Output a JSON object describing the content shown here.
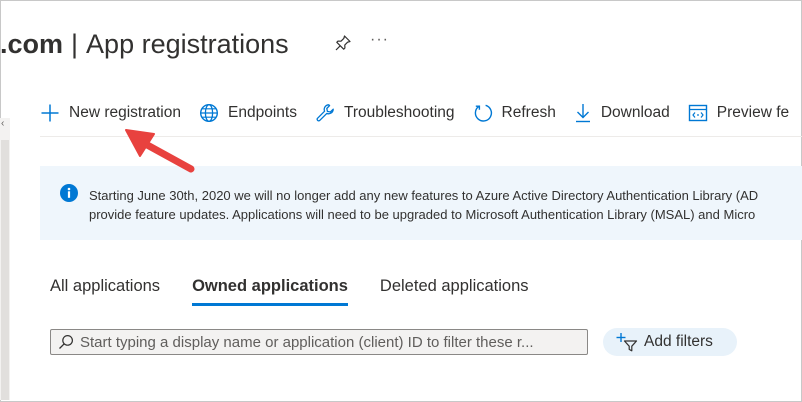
{
  "header": {
    "domain_suffix": ".com",
    "separator": "|",
    "title": "App registrations",
    "more_label": "···"
  },
  "toolbar": {
    "items": [
      {
        "label": "New registration",
        "icon": "plus-icon"
      },
      {
        "label": "Endpoints",
        "icon": "globe-icon"
      },
      {
        "label": "Troubleshooting",
        "icon": "wrench-icon"
      },
      {
        "label": "Refresh",
        "icon": "refresh-icon"
      },
      {
        "label": "Download",
        "icon": "download-icon"
      },
      {
        "label": "Preview fe",
        "icon": "preview-icon"
      }
    ]
  },
  "info_banner": {
    "line1": "Starting June 30th, 2020 we will no longer add any new features to Azure Active Directory Authentication Library (AD",
    "line2": "provide feature updates. Applications will need to be upgraded to Microsoft Authentication Library (MSAL) and Micro"
  },
  "tabs": [
    {
      "label": "All applications",
      "active": false
    },
    {
      "label": "Owned applications",
      "active": true
    },
    {
      "label": "Deleted applications",
      "active": false
    }
  ],
  "search": {
    "placeholder": "Start typing a display name or application (client) ID to filter these r...",
    "value": ""
  },
  "filters": {
    "add_label": "Add filters"
  },
  "colors": {
    "accent": "#0078d4",
    "callout_arrow": "#e8423f",
    "info_background": "#eff6fc"
  }
}
